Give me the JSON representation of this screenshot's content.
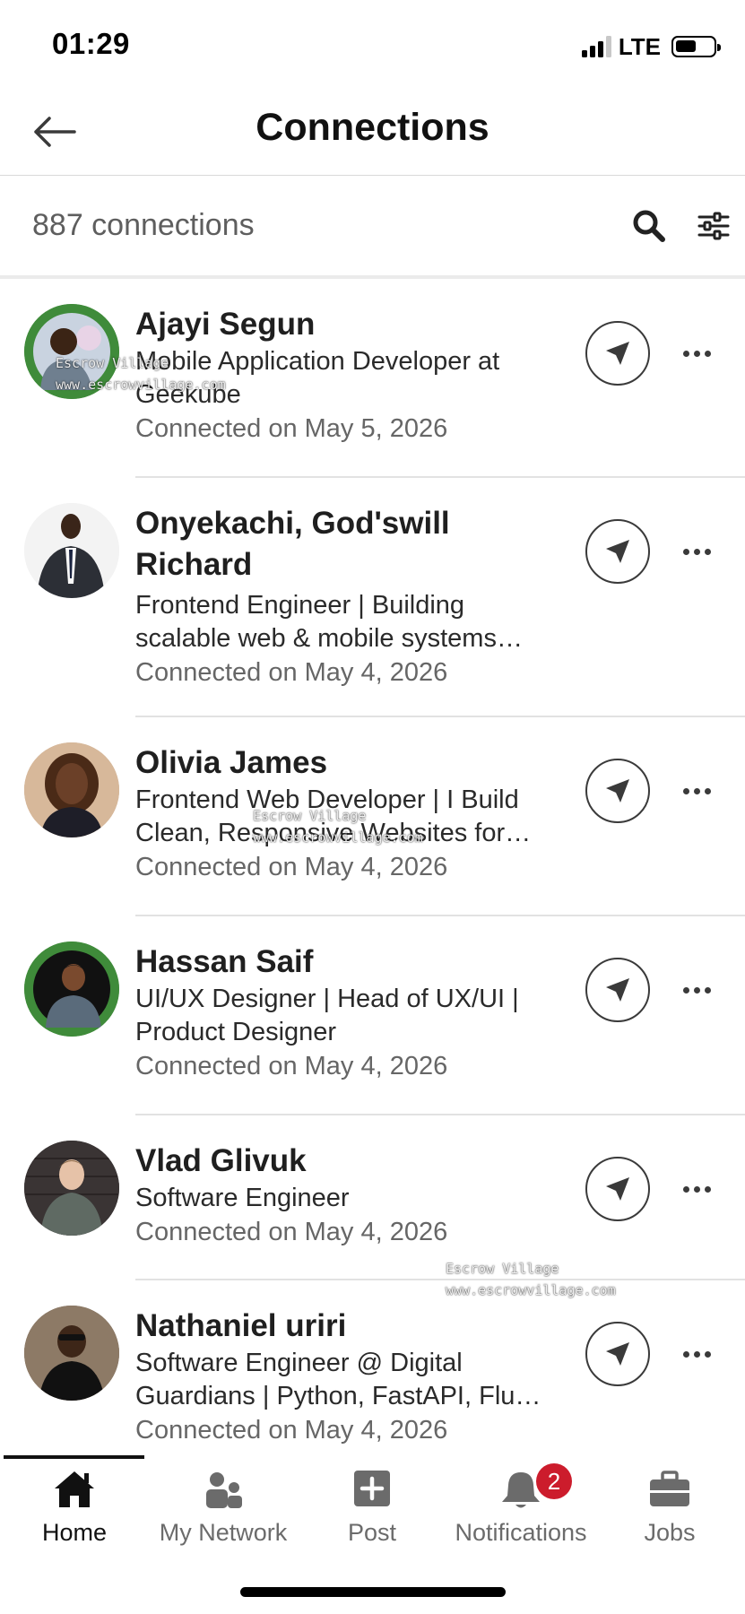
{
  "status_bar": {
    "time": "01:29",
    "network": "LTE"
  },
  "header": {
    "title": "Connections",
    "back_icon": "arrow-left-icon"
  },
  "summary": {
    "count_text": "887 connections",
    "search_icon": "search-icon",
    "filter_icon": "sliders-icon"
  },
  "connections": [
    {
      "name": "Ajayi Segun",
      "headline": "Mobile Application Developer at Geekube",
      "connected": "Connected on May 5, 2026",
      "open_to_work": true
    },
    {
      "name": "Onyekachi, God'swill Richard",
      "headline": "Frontend Engineer | Building scalable web & mobile systems…",
      "connected": "Connected on May 4, 2026",
      "open_to_work": false
    },
    {
      "name": "Olivia James",
      "headline": "Frontend Web Developer | I Build Clean, Responsive Websites for…",
      "connected": "Connected on May 4, 2026",
      "open_to_work": false
    },
    {
      "name": "Hassan Saif",
      "headline": "UI/UX Designer | Head of UX/UI | Product Designer",
      "connected": "Connected on May 4, 2026",
      "open_to_work": true
    },
    {
      "name": "Vlad Glivuk",
      "headline": "Software Engineer",
      "connected": "Connected on May 4, 2026",
      "open_to_work": false
    },
    {
      "name": "Nathaniel uriri",
      "headline": "Software Engineer @ Digital Guardians | Python, FastAPI, Flu…",
      "connected": "Connected on May 4, 2026",
      "open_to_work": false
    }
  ],
  "open_to_work_badge": "#OPENTOWORK",
  "watermark": {
    "line1": "Escrow Village",
    "line2": "www.escrowvillage.com"
  },
  "bottom_nav": {
    "items": [
      {
        "label": "Home",
        "icon": "home-icon",
        "active": true
      },
      {
        "label": "My Network",
        "icon": "network-icon",
        "active": false
      },
      {
        "label": "Post",
        "icon": "post-icon",
        "active": false
      },
      {
        "label": "Notifications",
        "icon": "bell-icon",
        "active": false
      },
      {
        "label": "Jobs",
        "icon": "briefcase-icon",
        "active": false
      }
    ],
    "notifications_badge": "2"
  },
  "colors": {
    "open_to_work_green": "#3f8b3a",
    "badge_red": "#cc1c2c",
    "text_dark": "#1f1f1f",
    "text_muted": "#666666"
  }
}
